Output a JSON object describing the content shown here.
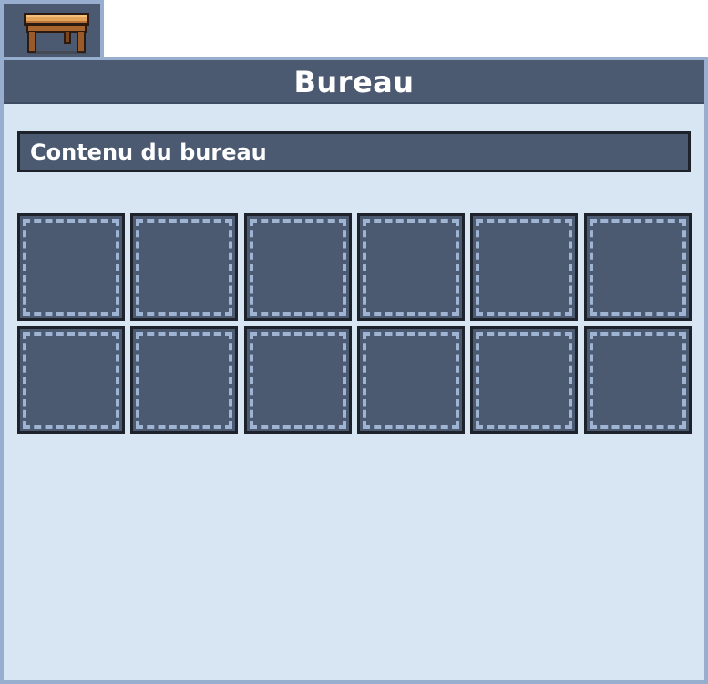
{
  "window": {
    "icon": "wooden-table-icon",
    "title": "Bureau"
  },
  "storage": {
    "section_label": "Contenu du bureau",
    "slots": [
      {
        "row": 1,
        "col": 1,
        "item": null
      },
      {
        "row": 1,
        "col": 2,
        "item": null
      },
      {
        "row": 1,
        "col": 3,
        "item": null
      },
      {
        "row": 1,
        "col": 4,
        "item": null
      },
      {
        "row": 1,
        "col": 5,
        "item": null
      },
      {
        "row": 1,
        "col": 6,
        "item": null
      },
      {
        "row": 2,
        "col": 1,
        "item": null
      },
      {
        "row": 2,
        "col": 2,
        "item": null
      },
      {
        "row": 2,
        "col": 3,
        "item": null
      },
      {
        "row": 2,
        "col": 4,
        "item": null
      },
      {
        "row": 2,
        "col": 5,
        "item": null
      },
      {
        "row": 2,
        "col": 6,
        "item": null
      }
    ]
  },
  "colors": {
    "panel_bg": "#d8e6f4",
    "panel_border": "#97aece",
    "header_bg": "#4b5a71",
    "slot_border": "#1e232b",
    "slot_dash": "#9eb4d2",
    "text": "#ffffff"
  }
}
